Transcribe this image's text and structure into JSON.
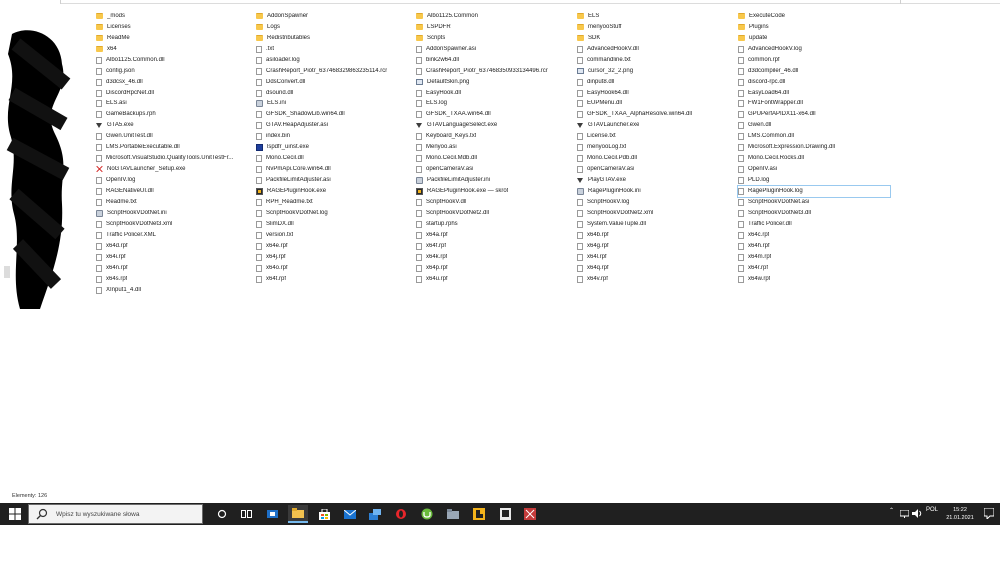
{
  "status_bar": {
    "items_count": "Elementy: 126"
  },
  "file_columns": [
    [
      {
        "name": "_mods",
        "icon": "folder"
      },
      {
        "name": "Licenses",
        "icon": "folder"
      },
      {
        "name": "ReadMe",
        "icon": "folder"
      },
      {
        "name": "x64",
        "icon": "folder"
      },
      {
        "name": "Albo1125.Common.dll",
        "icon": "file"
      },
      {
        "name": "config.json",
        "icon": "file"
      },
      {
        "name": "d3dcsx_46.dll",
        "icon": "file"
      },
      {
        "name": "DiscordRpcNet.dll",
        "icon": "file"
      },
      {
        "name": "ELS.asi",
        "icon": "file"
      },
      {
        "name": "GameBackups.rph",
        "icon": "file"
      },
      {
        "name": "GTA5.exe",
        "icon": "gta"
      },
      {
        "name": "Gwen.UnitTest.dll",
        "icon": "file"
      },
      {
        "name": "LMS.PortableExecutable.dll",
        "icon": "file"
      },
      {
        "name": "Microsoft.VisualStudio.QualityTools.UnitTestFr...",
        "icon": "file"
      },
      {
        "name": "NoGTAVLauncher_Setup.exe",
        "icon": "red"
      },
      {
        "name": "OpenIV.log",
        "icon": "file"
      },
      {
        "name": "RAGENativeUI.dll",
        "icon": "file"
      },
      {
        "name": "Readme.txt",
        "icon": "file"
      },
      {
        "name": "ScriptHookVDotNet.ini",
        "icon": "gear"
      },
      {
        "name": "ScriptHookVDotNet3.xml",
        "icon": "file"
      },
      {
        "name": "Traffic Policer.XML",
        "icon": "file"
      },
      {
        "name": "x64d.rpf",
        "icon": "file"
      },
      {
        "name": "x64i.rpf",
        "icon": "file"
      },
      {
        "name": "x64n.rpf",
        "icon": "file"
      },
      {
        "name": "x64s.rpf",
        "icon": "file"
      },
      {
        "name": "XInput1_4.dll",
        "icon": "file"
      }
    ],
    [
      {
        "name": "AddonSpawner",
        "icon": "folder"
      },
      {
        "name": "Logs",
        "icon": "folder"
      },
      {
        "name": "Redistributables",
        "icon": "folder"
      },
      {
        "name": ".txt",
        "icon": "file"
      },
      {
        "name": "asiloader.log",
        "icon": "file"
      },
      {
        "name": "CrashReport_Piotr_637468329863235114.rcr",
        "icon": "file"
      },
      {
        "name": "DdsConvert.dll",
        "icon": "file"
      },
      {
        "name": "dsound.dll",
        "icon": "file"
      },
      {
        "name": "ELS.ini",
        "icon": "gear"
      },
      {
        "name": "GFSDK_ShadowLib.win64.dll",
        "icon": "file"
      },
      {
        "name": "GTAV.HeapAdjuster.asi",
        "icon": "file"
      },
      {
        "name": "index.bin",
        "icon": "file"
      },
      {
        "name": "lspdfr_uinst.exe",
        "icon": "blue"
      },
      {
        "name": "Mono.Cecil.dll",
        "icon": "file"
      },
      {
        "name": "NvPmApi.Core.win64.dll",
        "icon": "file"
      },
      {
        "name": "PackfileLimitAdjuster.asi",
        "icon": "file"
      },
      {
        "name": "RAGEPluginHook.exe",
        "icon": "rage"
      },
      {
        "name": "RPH_Readme.txt",
        "icon": "file"
      },
      {
        "name": "ScriptHookVDotNet.log",
        "icon": "file"
      },
      {
        "name": "SlimDX.dll",
        "icon": "file"
      },
      {
        "name": "version.txt",
        "icon": "file"
      },
      {
        "name": "x64e.rpf",
        "icon": "file"
      },
      {
        "name": "x64j.rpf",
        "icon": "file"
      },
      {
        "name": "x64o.rpf",
        "icon": "file"
      },
      {
        "name": "x64t.rpf",
        "icon": "file"
      }
    ],
    [
      {
        "name": "Albo1125.Common",
        "icon": "folder"
      },
      {
        "name": "LSPDFR",
        "icon": "folder"
      },
      {
        "name": "Scripts",
        "icon": "folder"
      },
      {
        "name": "AddonSpawner.asi",
        "icon": "file"
      },
      {
        "name": "bink2w64.dll",
        "icon": "file"
      },
      {
        "name": "CrashReport_Piotr_637468350933134496.rcr",
        "icon": "file"
      },
      {
        "name": "DefaultSkin.png",
        "icon": "exe"
      },
      {
        "name": "EasyHook.dll",
        "icon": "file"
      },
      {
        "name": "ELS.log",
        "icon": "file"
      },
      {
        "name": "GFSDK_TXAA.win64.dll",
        "icon": "file"
      },
      {
        "name": "GTAVLanguageSelect.exe",
        "icon": "gta"
      },
      {
        "name": "Keyboard_Keys.txt",
        "icon": "file"
      },
      {
        "name": "Menyoo.asi",
        "icon": "file"
      },
      {
        "name": "Mono.Cecil.Mdb.dll",
        "icon": "file"
      },
      {
        "name": "openCameraV.asi",
        "icon": "file"
      },
      {
        "name": "PackfileLimitAdjuster.ini",
        "icon": "gear"
      },
      {
        "name": "RAGEPluginHook.exe — skrót",
        "icon": "rage"
      },
      {
        "name": "ScriptHookV.dll",
        "icon": "file"
      },
      {
        "name": "ScriptHookVDotNet2.dll",
        "icon": "file"
      },
      {
        "name": "startup.rphs",
        "icon": "file"
      },
      {
        "name": "x64a.rpf",
        "icon": "file"
      },
      {
        "name": "x64f.rpf",
        "icon": "file"
      },
      {
        "name": "x64k.rpf",
        "icon": "file"
      },
      {
        "name": "x64p.rpf",
        "icon": "file"
      },
      {
        "name": "x64u.rpf",
        "icon": "file"
      }
    ],
    [
      {
        "name": "ELS",
        "icon": "folder"
      },
      {
        "name": "menyooStuff",
        "icon": "folder"
      },
      {
        "name": "SDK",
        "icon": "folder"
      },
      {
        "name": "AdvancedHookV.dll",
        "icon": "file"
      },
      {
        "name": "commandline.txt",
        "icon": "file"
      },
      {
        "name": "cursor_32_2.png",
        "icon": "exe"
      },
      {
        "name": "dinput8.dll",
        "icon": "file"
      },
      {
        "name": "EasyHook64.dll",
        "icon": "file"
      },
      {
        "name": "EUPMenu.dll",
        "icon": "file"
      },
      {
        "name": "GFSDK_TXAA_AlphaResolve.win64.dll",
        "icon": "file"
      },
      {
        "name": "GTAVLauncher.exe",
        "icon": "gta"
      },
      {
        "name": "License.txt",
        "icon": "file"
      },
      {
        "name": "menyooLog.txt",
        "icon": "file"
      },
      {
        "name": "Mono.Cecil.Pdb.dll",
        "icon": "file"
      },
      {
        "name": "openCameraV.asi",
        "icon": "file"
      },
      {
        "name": "PlayGTAV.exe",
        "icon": "gta"
      },
      {
        "name": "RagePluginHook.ini",
        "icon": "gear"
      },
      {
        "name": "ScriptHookV.log",
        "icon": "file"
      },
      {
        "name": "ScriptHookVDotNet2.xml",
        "icon": "file"
      },
      {
        "name": "System.ValueTuple.dll",
        "icon": "file"
      },
      {
        "name": "x64b.rpf",
        "icon": "file"
      },
      {
        "name": "x64g.rpf",
        "icon": "file"
      },
      {
        "name": "x64l.rpf",
        "icon": "file"
      },
      {
        "name": "x64q.rpf",
        "icon": "file"
      },
      {
        "name": "x64v.rpf",
        "icon": "file"
      }
    ],
    [
      {
        "name": "ExecuteCode",
        "icon": "folder"
      },
      {
        "name": "Plugins",
        "icon": "folder"
      },
      {
        "name": "update",
        "icon": "folder"
      },
      {
        "name": "AdvancedHookV.log",
        "icon": "file"
      },
      {
        "name": "common.rpf",
        "icon": "file"
      },
      {
        "name": "d3dcompiler_46.dll",
        "icon": "file"
      },
      {
        "name": "discord-rpc.dll",
        "icon": "file"
      },
      {
        "name": "EasyLoad64.dll",
        "icon": "file"
      },
      {
        "name": "FW1FontWrapper.dll",
        "icon": "file"
      },
      {
        "name": "GPUPerfAPIDX11-x64.dll",
        "icon": "file"
      },
      {
        "name": "Gwen.dll",
        "icon": "file"
      },
      {
        "name": "LMS.Common.dll",
        "icon": "file"
      },
      {
        "name": "Microsoft.Expression.Drawing.dll",
        "icon": "file"
      },
      {
        "name": "Mono.Cecil.Rocks.dll",
        "icon": "file"
      },
      {
        "name": "OpenIV.asi",
        "icon": "file"
      },
      {
        "name": "PLD.log",
        "icon": "file"
      },
      {
        "name": "RagePluginHook.log",
        "icon": "file",
        "selected": true
      },
      {
        "name": "ScriptHookVDotNet.asi",
        "icon": "file"
      },
      {
        "name": "ScriptHookVDotNet3.dll",
        "icon": "file"
      },
      {
        "name": "Traffic Policer.dll",
        "icon": "file"
      },
      {
        "name": "x64c.rpf",
        "icon": "file"
      },
      {
        "name": "x64h.rpf",
        "icon": "file"
      },
      {
        "name": "x64m.rpf",
        "icon": "file"
      },
      {
        "name": "x64r.rpf",
        "icon": "file"
      },
      {
        "name": "x64w.rpf",
        "icon": "file"
      }
    ]
  ],
  "taskbar": {
    "search_placeholder": "Wpisz tu wyszukiwane słowa",
    "apps": [
      "cortana-icon",
      "task-view-icon",
      "media-icon",
      "file-explorer-icon",
      "store-icon",
      "mail-icon",
      "app-icon",
      "opera-icon",
      "utorrent-icon",
      "folder-icon",
      "rockstar-icon",
      "epic-icon",
      "snipping-icon"
    ],
    "language": "POL",
    "time": "15:22",
    "date": "21.01.2021",
    "colors": {
      "taskbar": "#202020",
      "accent": "#76b9ed"
    }
  }
}
